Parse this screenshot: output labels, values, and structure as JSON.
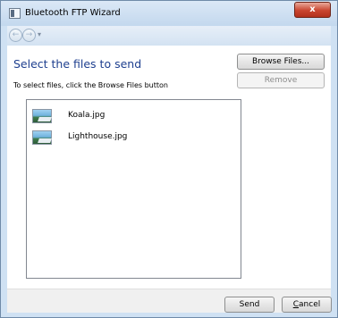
{
  "window": {
    "title": "Bluetooth FTP Wizard",
    "close_label": "x",
    "nav_chevron": "▾"
  },
  "icons": {
    "app": "bluetooth-app-icon",
    "back": "back-arrow-icon",
    "forward": "forward-arrow-icon",
    "close": "close-icon",
    "file": "image-file-icon"
  },
  "page": {
    "heading": "Select the files to send",
    "instruction": "To select files, click the Browse Files button"
  },
  "files": [
    {
      "name": "Koala.jpg"
    },
    {
      "name": "Lighthouse.jpg"
    }
  ],
  "buttons": {
    "browse": "Browse Files...",
    "remove": "Remove",
    "send": "Send",
    "cancel_first": "C",
    "cancel_rest": "ancel"
  },
  "colors": {
    "heading": "#1e3f8f",
    "frame": "#cfe1f3"
  }
}
